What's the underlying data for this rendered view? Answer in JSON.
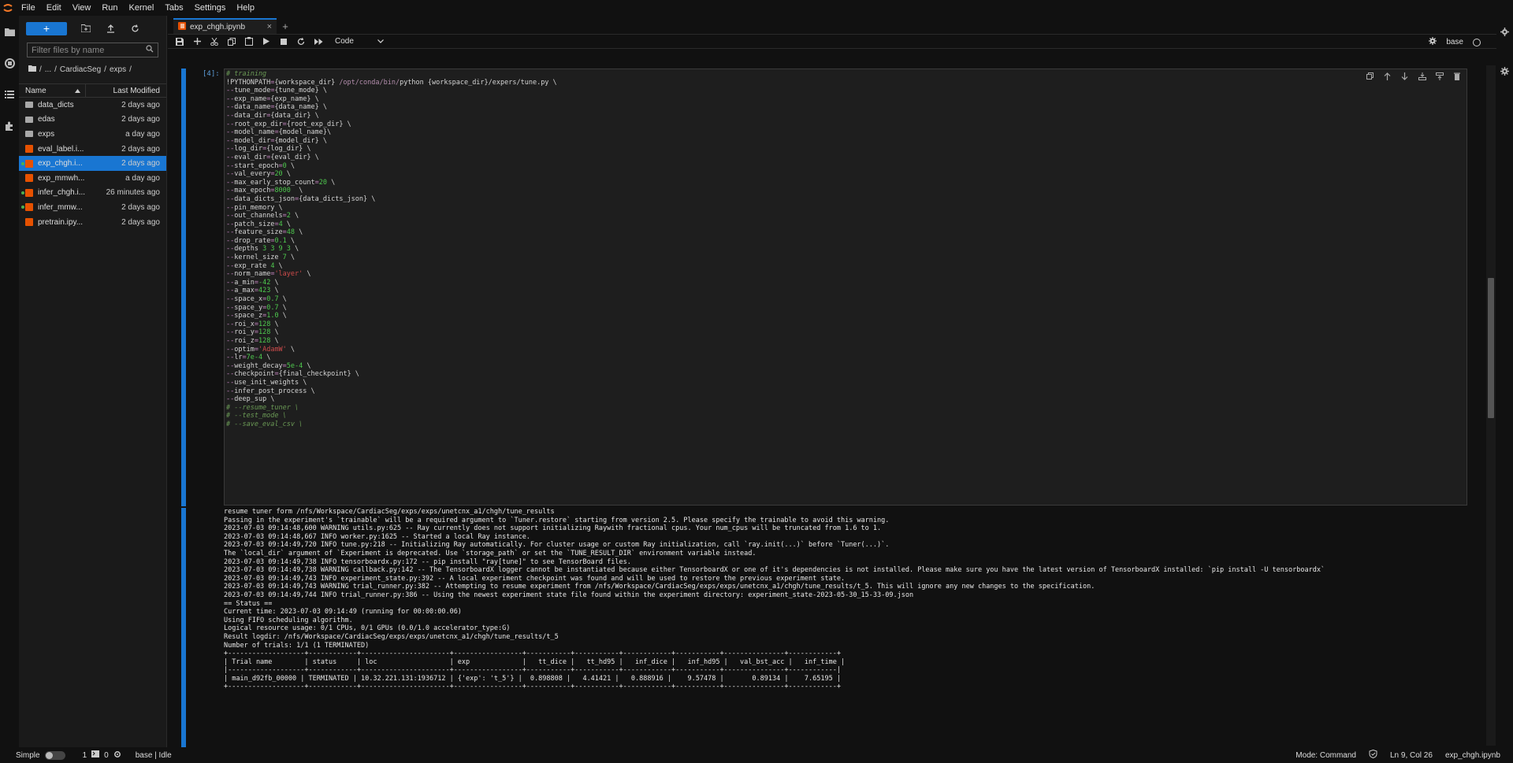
{
  "menubar": {
    "items": [
      "File",
      "Edit",
      "View",
      "Run",
      "Kernel",
      "Tabs",
      "Settings",
      "Help"
    ]
  },
  "filebrowser": {
    "new_label": "+",
    "filter_placeholder": "Filter files by name",
    "breadcrumb": [
      "/",
      "...",
      "/",
      "CardiacSeg",
      "/",
      "exps",
      "/"
    ],
    "col_name": "Name",
    "col_modified": "Last Modified",
    "files": [
      {
        "name": "data_dicts",
        "modified": "2 days ago",
        "type": "folder",
        "running": false,
        "selected": false
      },
      {
        "name": "edas",
        "modified": "2 days ago",
        "type": "folder",
        "running": false,
        "selected": false
      },
      {
        "name": "exps",
        "modified": "a day ago",
        "type": "folder",
        "running": false,
        "selected": false
      },
      {
        "name": "eval_label.i...",
        "modified": "2 days ago",
        "type": "notebook",
        "running": false,
        "selected": false
      },
      {
        "name": "exp_chgh.i...",
        "modified": "2 days ago",
        "type": "notebook",
        "running": true,
        "selected": true
      },
      {
        "name": "exp_mmwh...",
        "modified": "a day ago",
        "type": "notebook",
        "running": false,
        "selected": false
      },
      {
        "name": "infer_chgh.i...",
        "modified": "26 minutes ago",
        "type": "notebook",
        "running": true,
        "selected": false
      },
      {
        "name": "infer_mmw...",
        "modified": "2 days ago",
        "type": "notebook",
        "running": true,
        "selected": false
      },
      {
        "name": "pretrain.ipy...",
        "modified": "2 days ago",
        "type": "notebook",
        "running": false,
        "selected": false
      }
    ]
  },
  "tab": {
    "title": "exp_chgh.ipynb",
    "close": "×",
    "add": "+"
  },
  "toolbar": {
    "cell_type": "Code",
    "kernel_name": "base"
  },
  "cell": {
    "prompt": "[4]:",
    "code": [
      "# training",
      "!PYTHONPATH={workspace_dir} /opt/conda/bin/python {workspace_dir}/expers/tune.py \\",
      "--tune_mode={tune_mode} \\",
      "--exp_name={exp_name} \\",
      "--data_name={data_name} \\",
      "--data_dir={data_dir} \\",
      "--root_exp_dir={root_exp_dir} \\",
      "--model_name={model_name}\\",
      "--model_dir={model_dir} \\",
      "--log_dir={log_dir} \\",
      "--eval_dir={eval_dir} \\",
      "--start_epoch=0 \\",
      "--val_every=20 \\",
      "--max_early_stop_count=20 \\",
      "--max_epoch=8000  \\",
      "--data_dicts_json={data_dicts_json} \\",
      "--pin_memory \\",
      "--out_channels=2 \\",
      "--patch_size=4 \\",
      "--feature_size=48 \\",
      "--drop_rate=0.1 \\",
      "--depths 3 3 9 3 \\",
      "--kernel_size 7 \\",
      "--exp_rate 4 \\",
      "--norm_name='layer' \\",
      "--a_min=-42 \\",
      "--a_max=423 \\",
      "--space_x=0.7 \\",
      "--space_y=0.7 \\",
      "--space_z=1.0 \\",
      "--roi_x=128 \\",
      "--roi_y=128 \\",
      "--roi_z=128 \\",
      "--optim='AdamW' \\",
      "--lr=7e-4 \\",
      "--weight_decay=5e-4 \\",
      "--checkpoint={final_checkpoint} \\",
      "--use_init_weights \\",
      "--infer_post_process \\",
      "--deep_sup \\",
      "# --resume_tuner \\",
      "# --test_mode \\",
      "# --save_eval_csv \\"
    ],
    "output": [
      "resume tuner form /nfs/Workspace/CardiacSeg/exps/exps/unetcnx_a1/chgh/tune_results",
      "Passing in the experiment's `trainable` will be a required argument to `Tuner.restore` starting from version 2.5. Please specify the trainable to avoid this warning.",
      "2023-07-03 09:14:48,600 WARNING utils.py:625 -- Ray currently does not support initializing Raywith fractional cpus. Your num_cpus will be truncated from 1.6 to 1.",
      "2023-07-03 09:14:48,667 INFO worker.py:1625 -- Started a local Ray instance.",
      "2023-07-03 09:14:49,720 INFO tune.py:218 -- Initializing Ray automatically. For cluster usage or custom Ray initialization, call `ray.init(...)` before `Tuner(...)`.",
      "The `local_dir` argument of `Experiment is deprecated. Use `storage_path` or set the `TUNE_RESULT_DIR` environment variable instead.",
      "2023-07-03 09:14:49,738 INFO tensorboardx.py:172 -- pip install \"ray[tune]\" to see TensorBoard files.",
      "2023-07-03 09:14:49,738 WARNING callback.py:142 -- The TensorboardX logger cannot be instantiated because either TensorboardX or one of it's dependencies is not installed. Please make sure you have the latest version of TensorboardX installed: `pip install -U tensorboardx`",
      "2023-07-03 09:14:49,743 INFO experiment_state.py:392 -- A local experiment checkpoint was found and will be used to restore the previous experiment state.",
      "2023-07-03 09:14:49,743 WARNING trial_runner.py:382 -- Attempting to resume experiment from /nfs/Workspace/CardiacSeg/exps/exps/unetcnx_a1/chgh/tune_results/t_5. This will ignore any new changes to the specification.",
      "2023-07-03 09:14:49,744 INFO trial_runner.py:386 -- Using the newest experiment state file found within the experiment directory: experiment_state-2023-05-30_15-33-09.json",
      "== Status ==",
      "Current time: 2023-07-03 09:14:49 (running for 00:00:00.06)",
      "Using FIFO scheduling algorithm.",
      "Logical resource usage: 0/1 CPUs, 0/1 GPUs (0.0/1.0 accelerator_type:G)",
      "Result logdir: /nfs/Workspace/CardiacSeg/exps/exps/unetcnx_a1/chgh/tune_results/t_5",
      "Number of trials: 1/1 (1 TERMINATED)",
      "+-------------------+------------+----------------------+-----------------+-----------+-----------+------------+-----------+---------------+------------+",
      "| Trial name        | status     | loc                  | exp             |   tt_dice |   tt_hd95 |   inf_dice |   inf_hd95 |   val_bst_acc |   inf_time |",
      "|-------------------+------------+----------------------+-----------------+-----------+-----------+------------+-----------+---------------+------------|",
      "| main_d92fb_00000 | TERMINATED | 10.32.221.131:1936712 | {'exp': 't_5'} |  0.898808 |   4.41421 |   0.888916 |    9.57478 |       0.89134 |    7.65195 |",
      "+-------------------+------------+----------------------+-----------------+-----------+-----------+------------+-----------+---------------+------------+"
    ]
  },
  "statusbar": {
    "mode_label": "Simple",
    "count1": "1",
    "count2": "0",
    "kernel_status": "base | Idle",
    "mode": "Mode: Command",
    "position": "Ln 9, Col 26",
    "filename": "exp_chgh.ipynb"
  },
  "colors": {
    "accent": "#1976d2",
    "notebook_icon": "#e65100",
    "running_dot": "#4caf50"
  }
}
